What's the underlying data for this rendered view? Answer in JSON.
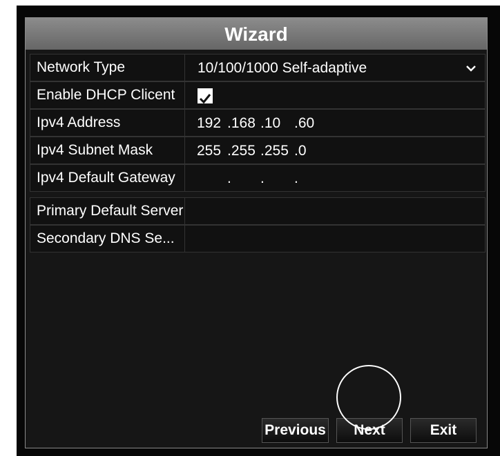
{
  "window": {
    "title": "Wizard"
  },
  "fields": {
    "network_type": {
      "label": "Network Type",
      "value": "10/100/1000 Self-adaptive"
    },
    "dhcp": {
      "label": "Enable DHCP Clicent",
      "checked": true
    },
    "ipv4_address": {
      "label": "Ipv4 Address",
      "octets": [
        "192",
        ".168",
        ".10",
        ".60"
      ]
    },
    "subnet_mask": {
      "label": "Ipv4 Subnet Mask",
      "octets": [
        "255",
        ".255",
        ".255",
        ".0"
      ]
    },
    "gateway": {
      "label": "Ipv4 Default Gateway",
      "octets": [
        "",
        ".",
        ".",
        "."
      ]
    },
    "primary_dns": {
      "label": "Primary Default Server",
      "value": ""
    },
    "secondary_dns": {
      "label": "Secondary DNS Se...",
      "value": ""
    }
  },
  "buttons": {
    "previous": "Previous",
    "next": "Next",
    "exit": "Exit"
  },
  "icons": {
    "dropdown": "chevron-down-icon",
    "checkbox": "check-icon"
  },
  "colors": {
    "title_bar": "#7a7a7a",
    "background": "#161616",
    "text": "#ffffff"
  }
}
